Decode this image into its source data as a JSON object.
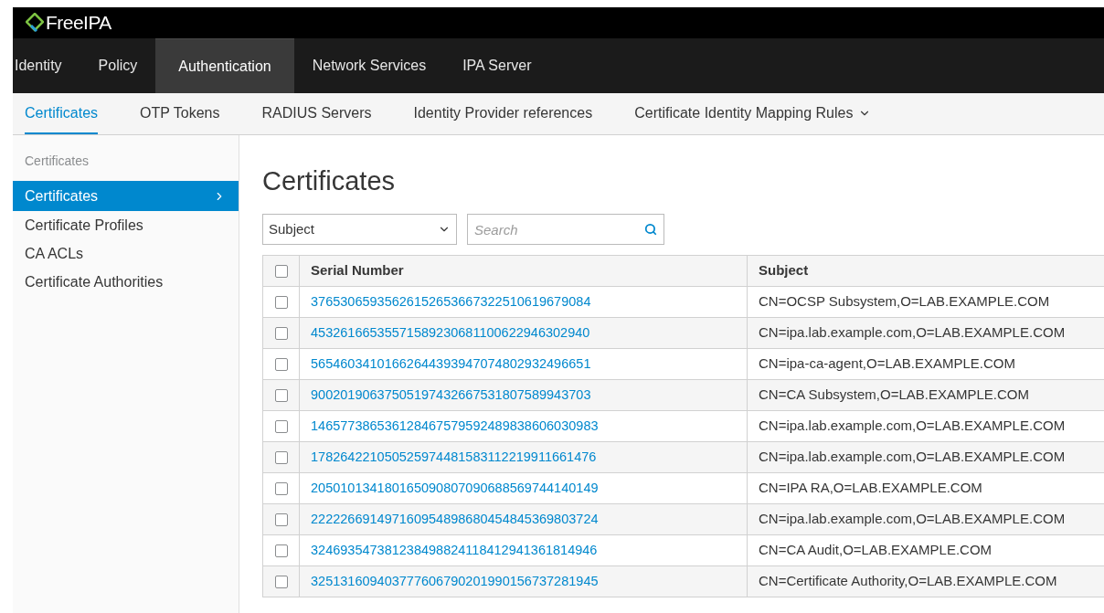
{
  "brand": {
    "name": "FreeIPA"
  },
  "nav": [
    {
      "label": "Identity",
      "selected": false
    },
    {
      "label": "Policy",
      "selected": false
    },
    {
      "label": "Authentication",
      "selected": true
    },
    {
      "label": "Network Services",
      "selected": false
    },
    {
      "label": "IPA Server",
      "selected": false
    }
  ],
  "subnav": [
    {
      "label": "Certificates",
      "selected": true,
      "dropdown": false
    },
    {
      "label": "OTP Tokens",
      "selected": false,
      "dropdown": false
    },
    {
      "label": "RADIUS Servers",
      "selected": false,
      "dropdown": false
    },
    {
      "label": "Identity Provider references",
      "selected": false,
      "dropdown": false
    },
    {
      "label": "Certificate Identity Mapping Rules",
      "selected": false,
      "dropdown": true
    }
  ],
  "sidebar": {
    "heading": "Certificates",
    "items": [
      {
        "label": "Certificates",
        "selected": true
      },
      {
        "label": "Certificate Profiles",
        "selected": false
      },
      {
        "label": "CA ACLs",
        "selected": false
      },
      {
        "label": "Certificate Authorities",
        "selected": false
      }
    ]
  },
  "page_title": "Certificates",
  "filter": {
    "value": "Subject"
  },
  "search": {
    "placeholder": "Search"
  },
  "table": {
    "select_all": {
      "checked": false
    },
    "columns": [
      "Serial Number",
      "Subject"
    ],
    "rows": [
      {
        "checked": false,
        "serial": "37653065935626152653667322510619679084",
        "subject": "CN=OCSP Subsystem,O=LAB.EXAMPLE.COM"
      },
      {
        "checked": false,
        "serial": "45326166535571589230681100622946302940",
        "subject": "CN=ipa.lab.example.com,O=LAB.EXAMPLE.COM"
      },
      {
        "checked": false,
        "serial": "56546034101662644393947074802932496651",
        "subject": "CN=ipa-ca-agent,O=LAB.EXAMPLE.COM"
      },
      {
        "checked": false,
        "serial": "90020190637505197432667531807589943703",
        "subject": "CN=CA Subsystem,O=LAB.EXAMPLE.COM"
      },
      {
        "checked": false,
        "serial": "146577386536128467579592489838606030983",
        "subject": "CN=ipa.lab.example.com,O=LAB.EXAMPLE.COM"
      },
      {
        "checked": false,
        "serial": "178264221050525974481583112219911661476",
        "subject": "CN=ipa.lab.example.com,O=LAB.EXAMPLE.COM"
      },
      {
        "checked": false,
        "serial": "205010134180165090807090688569744140149",
        "subject": "CN=IPA RA,O=LAB.EXAMPLE.COM"
      },
      {
        "checked": false,
        "serial": "222226691497160954898680454845369803724",
        "subject": "CN=ipa.lab.example.com,O=LAB.EXAMPLE.COM"
      },
      {
        "checked": false,
        "serial": "324693547381238498824118412941361814946",
        "subject": "CN=CA Audit,O=LAB.EXAMPLE.COM"
      },
      {
        "checked": false,
        "serial": "325131609403777606790201990156737281945",
        "subject": "CN=Certificate Authority,O=LAB.EXAMPLE.COM"
      }
    ]
  }
}
